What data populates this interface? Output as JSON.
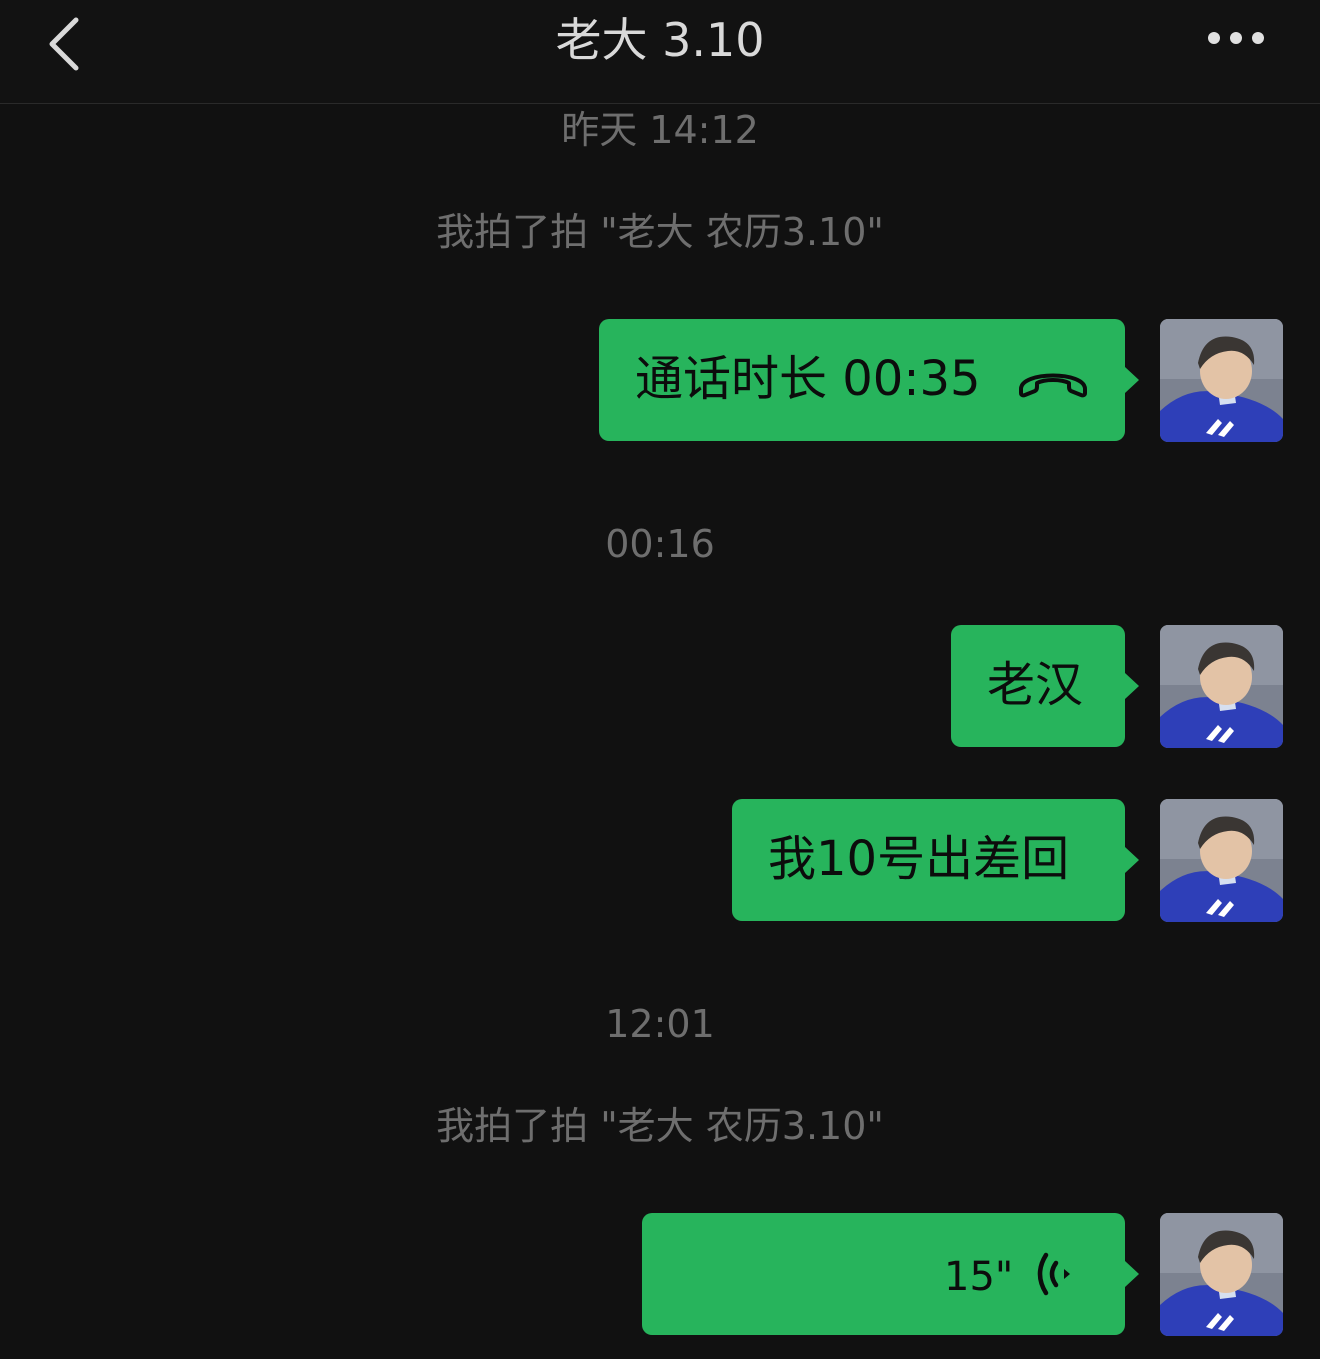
{
  "header": {
    "title": "老大 3.10",
    "back_icon": "chevron-left-icon",
    "more_icon": "more-dots-icon"
  },
  "messages": {
    "timestamp_1": "昨天 14:12",
    "pat_1": "我拍了拍 \"老大 农历3.10\"",
    "call_text": "通话时长 00:35",
    "call_icon": "phone-hangup-icon",
    "timestamp_2": "00:16",
    "text_1": "老汉",
    "text_2": "我10号出差回",
    "timestamp_3": "12:01",
    "pat_2": "我拍了拍 \"老大 农历3.10\"",
    "voice_duration": "15\"",
    "voice_icon": "voice-wave-icon"
  },
  "colors": {
    "background": "#111111",
    "bubble_green": "#27b45c",
    "system_text": "#6e6e6e"
  }
}
